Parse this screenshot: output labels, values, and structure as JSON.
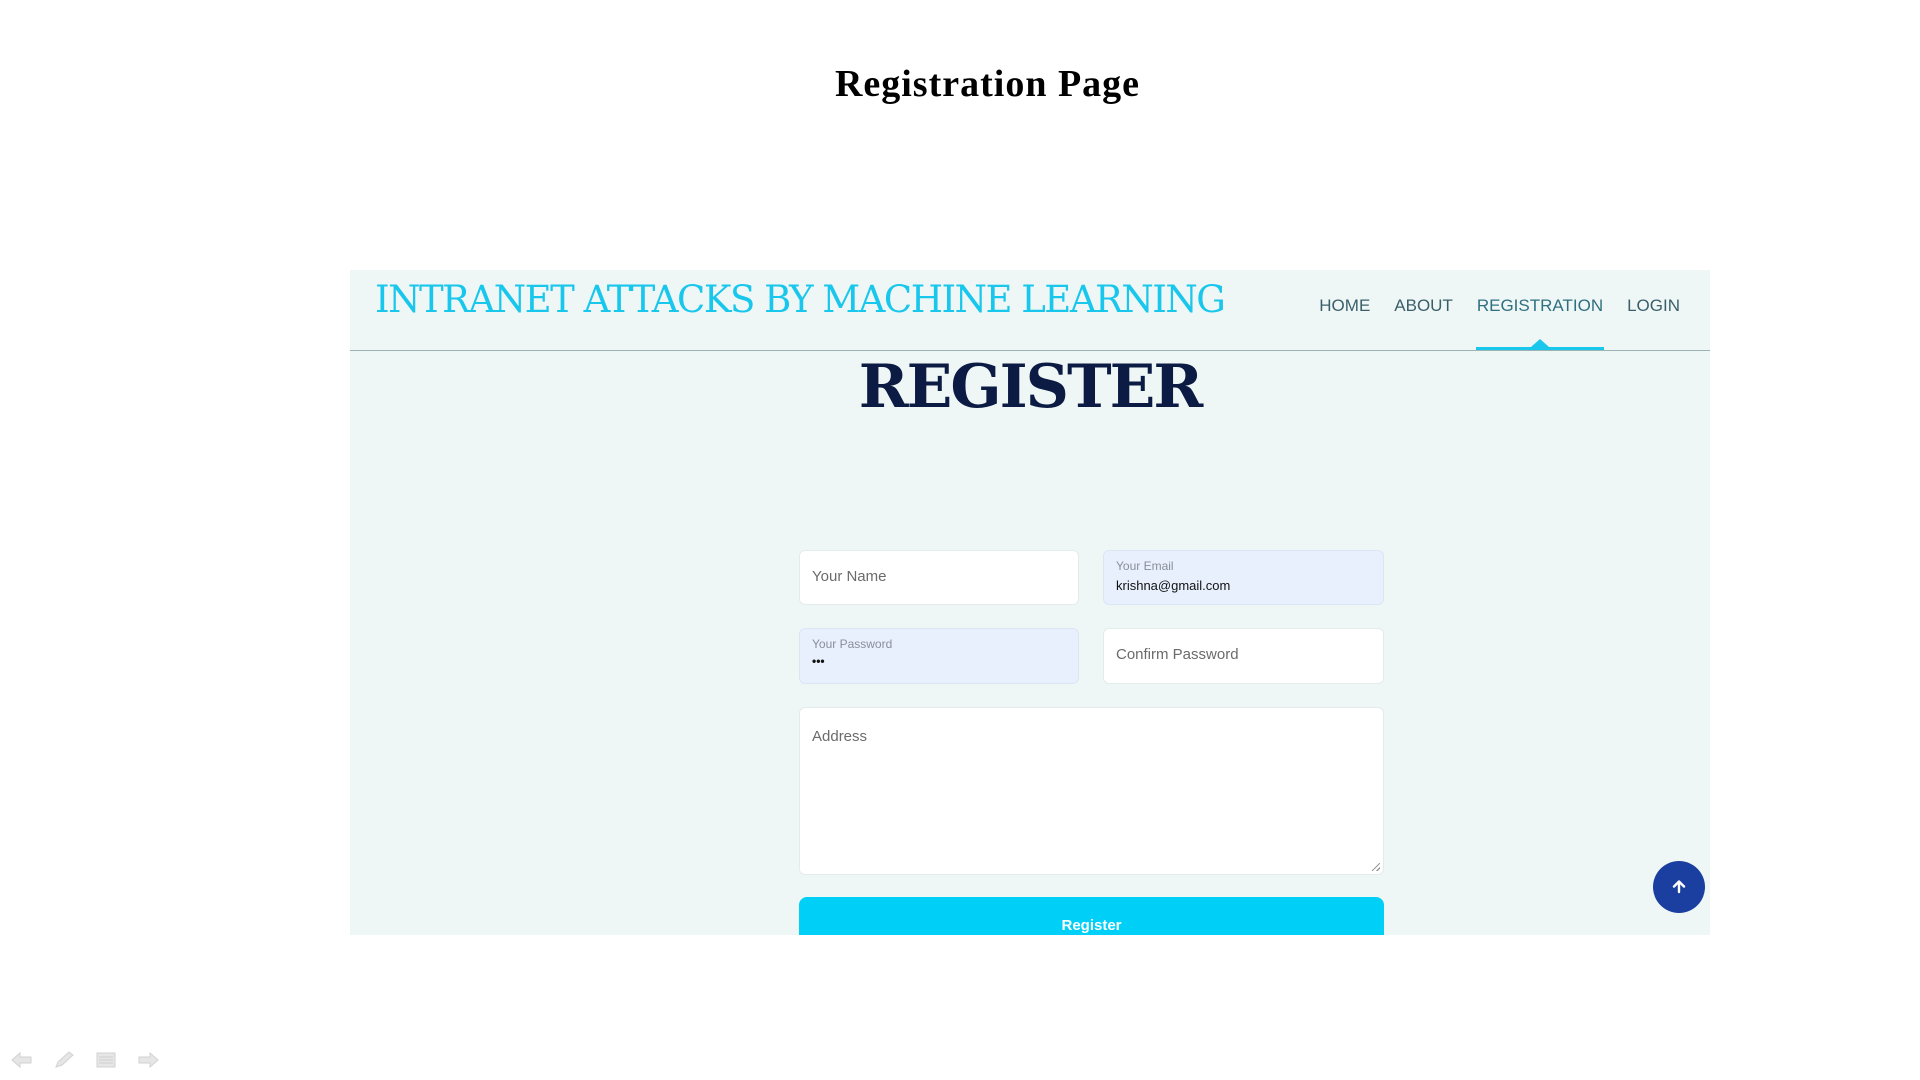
{
  "slide": {
    "title": "Registration Page"
  },
  "app": {
    "brand": "INTRANET ATTACKS BY MACHINE LEARNING",
    "nav": [
      {
        "label": "HOME",
        "active": false
      },
      {
        "label": "ABOUT",
        "active": false
      },
      {
        "label": "REGISTRATION",
        "active": true
      },
      {
        "label": "LOGIN",
        "active": false
      }
    ]
  },
  "form": {
    "heading": "REGISTER",
    "name": {
      "placeholder": "Your Name",
      "value": ""
    },
    "email": {
      "label": "Your Email",
      "value": "krishna@gmail.com"
    },
    "password": {
      "label": "Your Password",
      "value": "•••"
    },
    "confirm": {
      "placeholder": "Confirm Password",
      "value": ""
    },
    "address": {
      "placeholder": "Address",
      "value": ""
    },
    "submit_label": "Register"
  },
  "icons": {
    "scroll_top": "arrow-up-icon",
    "slide_controls": [
      "prev-slide-icon",
      "pen-icon",
      "menu-icon",
      "next-slide-icon"
    ]
  },
  "colors": {
    "brand": "#19c6ec",
    "heading": "#0b1b44",
    "button": "#00cff7",
    "scroll_top": "#1a3fa0",
    "autofill": "#e8f0fe"
  }
}
